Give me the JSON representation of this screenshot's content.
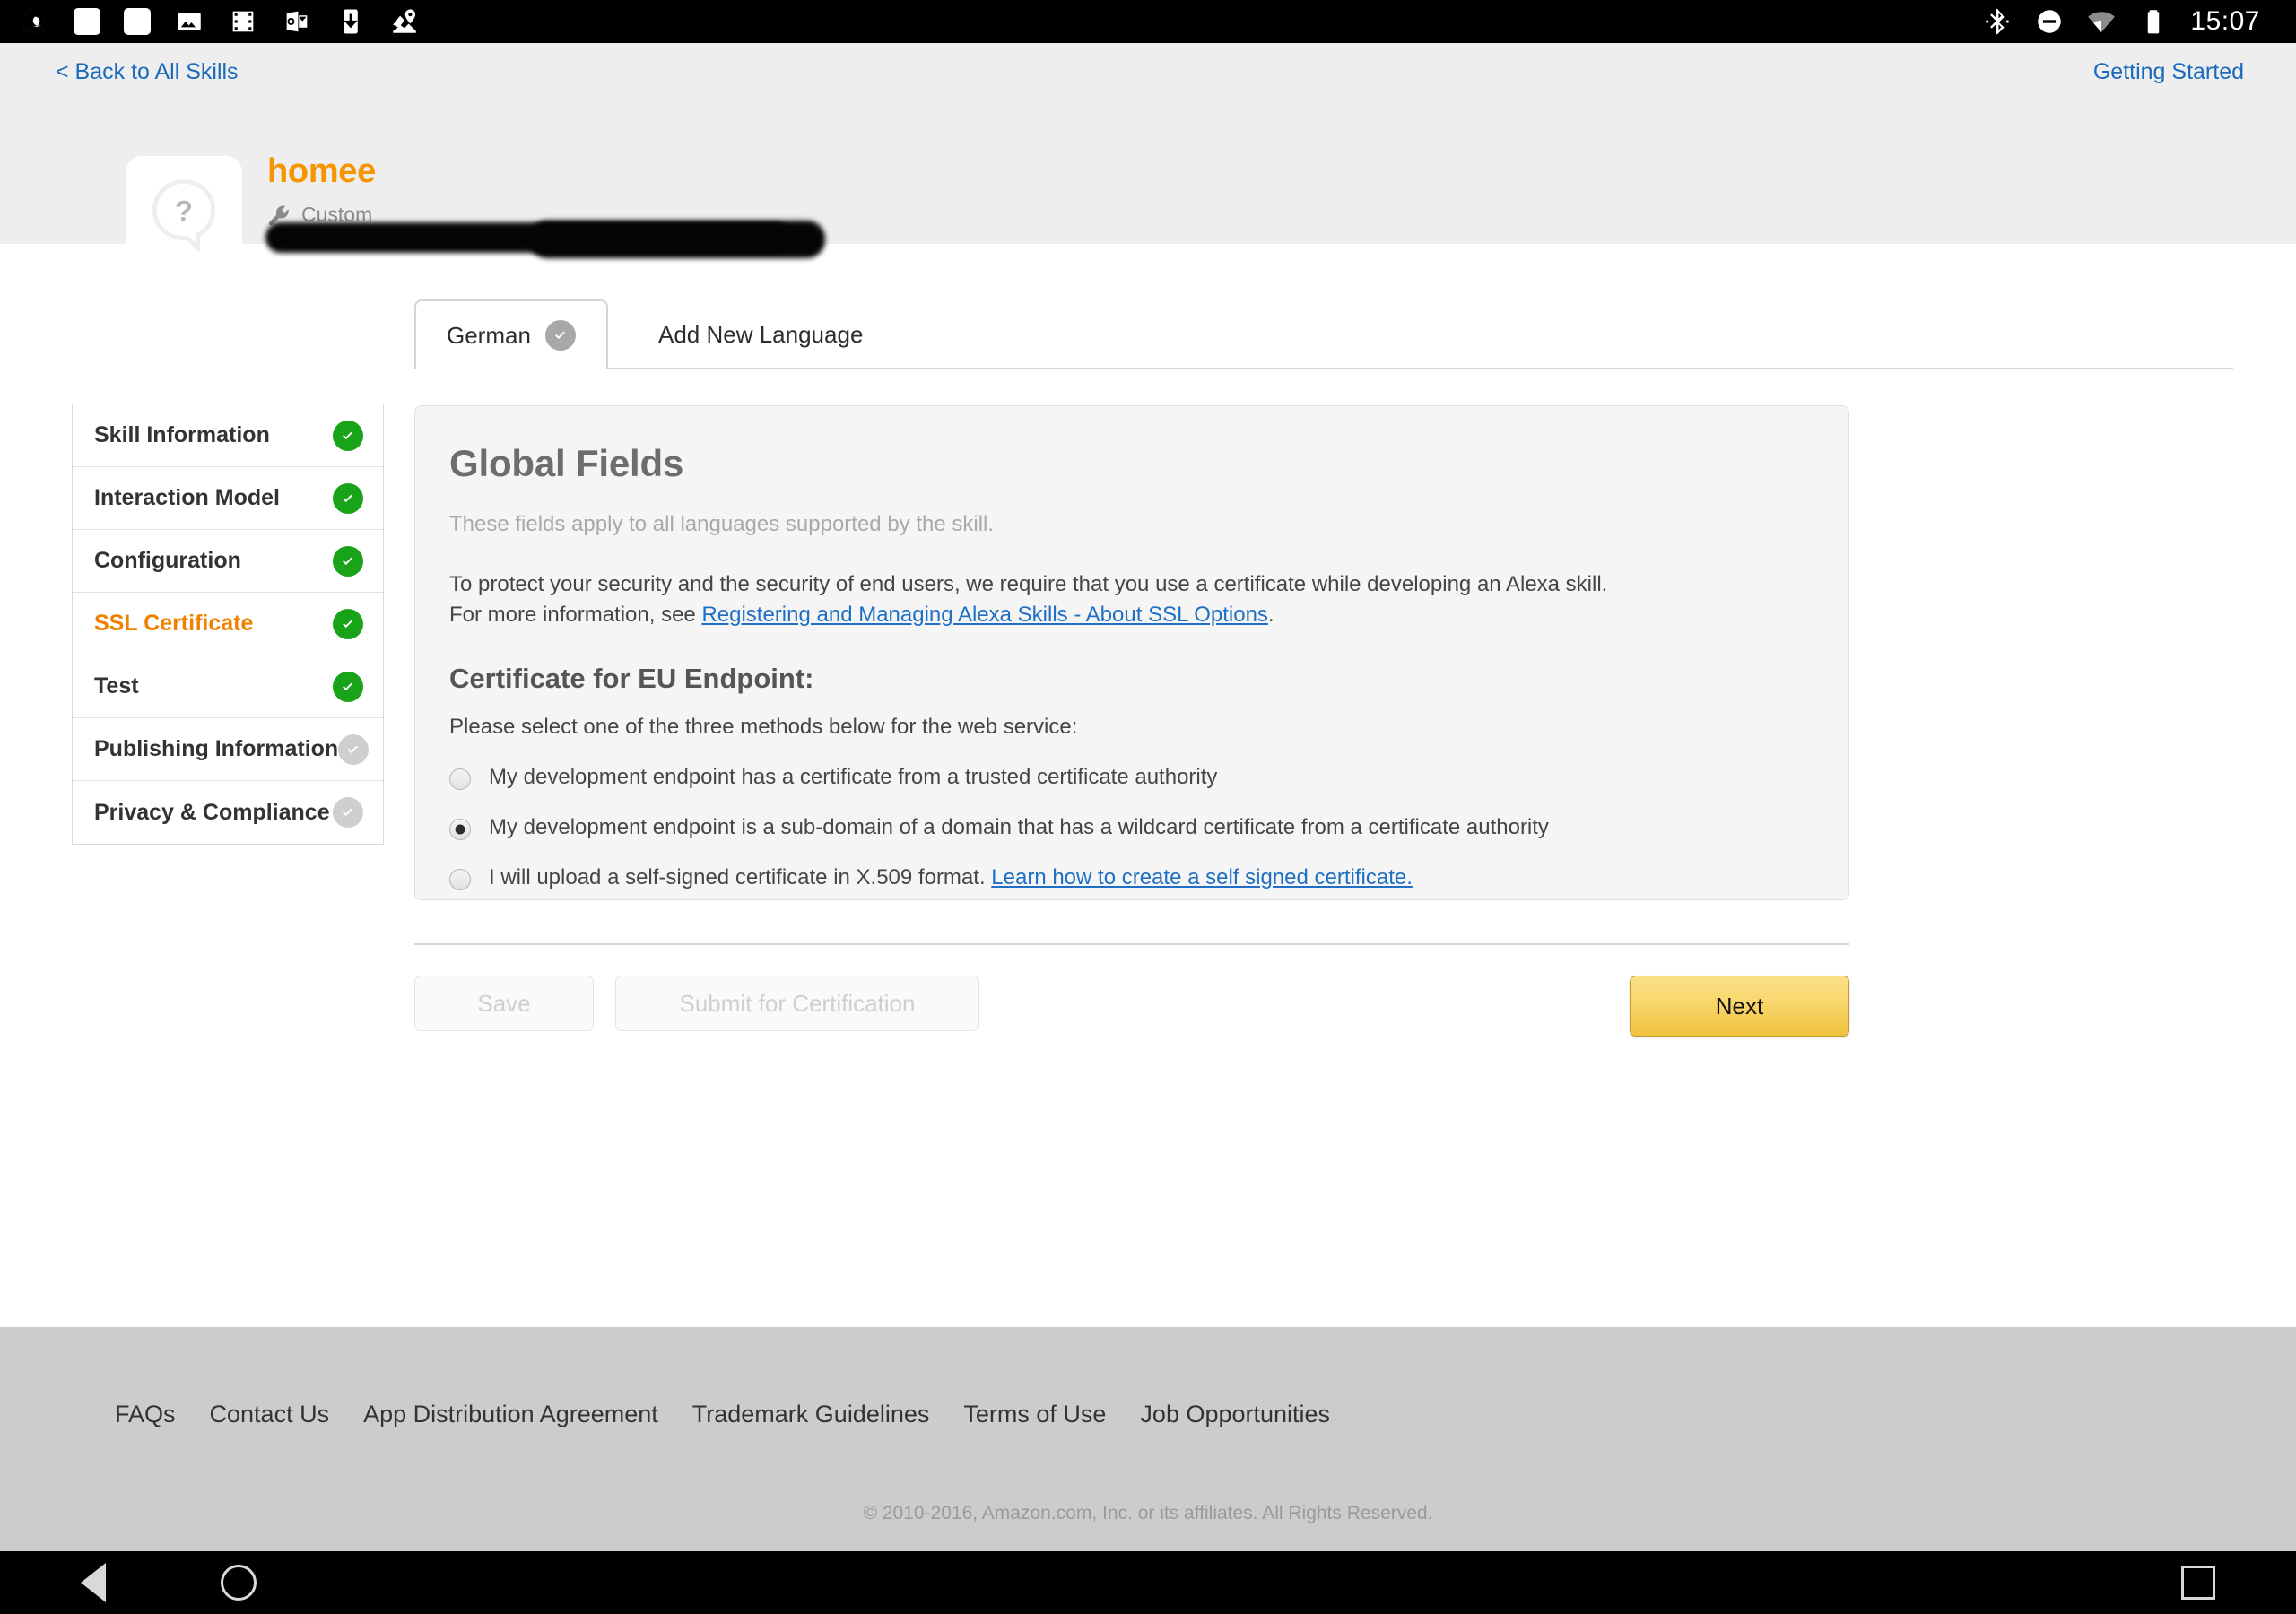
{
  "status_bar": {
    "time": "15:07",
    "left_icons": [
      "spiral-app-icon",
      "white-square-icon",
      "white-square-icon",
      "photos-icon",
      "film-strip-icon",
      "outlook-icon",
      "download-icon",
      "maps-icon"
    ],
    "right_icons": [
      "bluetooth-icon",
      "do-not-disturb-icon",
      "wifi-icon",
      "battery-icon"
    ]
  },
  "header": {
    "back_link": "< Back to All Skills",
    "getting_started": "Getting Started",
    "skill_name": "homee",
    "skill_icon": "question-speech-bubble-icon",
    "skill_type": "Custom",
    "skill_type_icon": "wrench-icon",
    "redacted_note": "redacted"
  },
  "tabs": [
    {
      "label": "German",
      "active": true,
      "status": "complete-grey"
    },
    {
      "label": "Add New Language",
      "active": false,
      "status": "none"
    }
  ],
  "sidebar": {
    "items": [
      {
        "label": "Skill Information",
        "status": "complete",
        "active": false
      },
      {
        "label": "Interaction Model",
        "status": "complete",
        "active": false
      },
      {
        "label": "Configuration",
        "status": "complete",
        "active": false
      },
      {
        "label": "SSL Certificate",
        "status": "complete",
        "active": true
      },
      {
        "label": "Test",
        "status": "complete",
        "active": false
      },
      {
        "label": "Publishing Information",
        "status": "incomplete",
        "active": false
      },
      {
        "label": "Privacy & Compliance",
        "status": "incomplete",
        "active": false
      }
    ]
  },
  "main": {
    "title": "Global Fields",
    "subtitle": "These fields apply to all languages supported by the skill.",
    "paragraph_line1": "To protect your security and the security of end users, we require that you use a certificate while developing an Alexa skill.",
    "paragraph_line2_prefix": "For more information, see ",
    "paragraph_link": "Registering and Managing Alexa Skills - About SSL Options",
    "paragraph_line2_suffix": ".",
    "section_title": "Certificate for EU Endpoint:",
    "section_subtitle": "Please select one of the three methods below for the web service:",
    "options": [
      {
        "label": "My development endpoint has a certificate from a trusted certificate authority",
        "selected": false,
        "link": ""
      },
      {
        "label": "My development endpoint is a sub-domain of a domain that has a wildcard certificate from a certificate authority",
        "selected": true,
        "link": ""
      },
      {
        "label": "I will upload a self-signed certificate in X.509 format. ",
        "selected": false,
        "link": "Learn how to create a self signed certificate."
      }
    ]
  },
  "actions": {
    "save_label": "Save",
    "save_enabled": false,
    "submit_label": "Submit for Certification",
    "submit_enabled": false,
    "next_label": "Next",
    "next_enabled": true
  },
  "footer": {
    "links": [
      "FAQs",
      "Contact Us",
      "App Distribution Agreement",
      "Trademark Guidelines",
      "Terms of Use",
      "Job Opportunities"
    ],
    "copyright": "© 2010-2016, Amazon.com, Inc. or its affiliates. All Rights Reserved."
  },
  "nav_bar": {
    "back": "back-triangle-icon",
    "home": "home-circle-icon",
    "recents": "recents-square-icon"
  },
  "colors": {
    "accent_orange": "#f79500",
    "link_blue": "#1a6bbd",
    "complete_green": "#19a319",
    "incomplete_grey": "#cfcfcf",
    "next_button_gold": "#f2c23e"
  }
}
